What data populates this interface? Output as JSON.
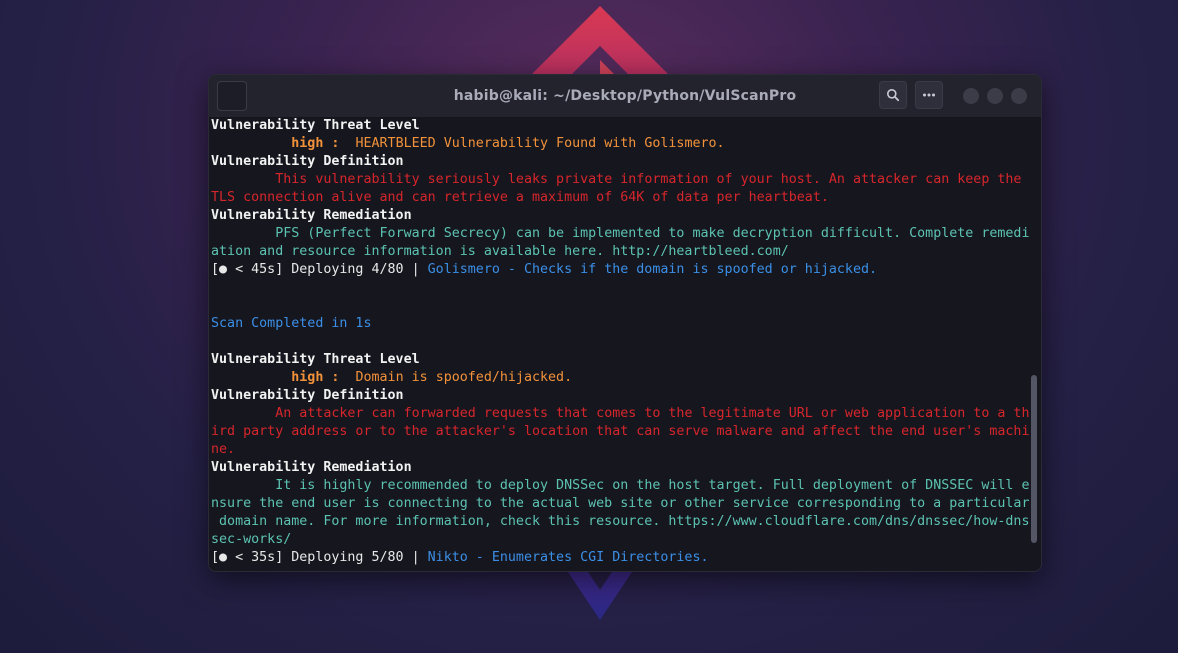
{
  "window": {
    "title": "habib@kali: ~/Desktop/Python/VulScanPro"
  },
  "colors": {
    "threat_high": "#f2923a",
    "definition_text": "#d6262b",
    "remediation_text": "#5cc3b1",
    "deploy_info": "#3b8fe6",
    "terminal_bg": "#16161e"
  },
  "icons": {
    "search": "search-icon",
    "menu": "more-dots-icon"
  },
  "terminal": {
    "block1": {
      "threat_heading": "Vulnerability Threat Level",
      "severity_label": "high : ",
      "threat_text": " HEARTBLEED Vulnerability Found with Golismero.",
      "definition_heading": "Vulnerability Definition",
      "definition_line1": "This vulnerability seriously leaks private information of your host. An attacker can keep the",
      "definition_line2": "TLS connection alive and can retrieve a maximum of 64K of data per heartbeat.",
      "remediation_heading": "Vulnerability Remediation",
      "remediation_line1": "PFS (Perfect Forward Secrecy) can be implemented to make decryption difficult. Complete remedi",
      "remediation_line2": "ation and resource information is available here. http://heartbleed.com/",
      "deploy_prefix": "[● < 45s] Deploying 4/80 | ",
      "deploy_desc": "Golismero - Checks if the domain is spoofed or hijacked."
    },
    "scan_completed": "Scan Completed in 1s",
    "block2": {
      "threat_heading": "Vulnerability Threat Level",
      "severity_label": "high : ",
      "threat_text": " Domain is spoofed/hijacked.",
      "definition_heading": "Vulnerability Definition",
      "definition_line1": "An attacker can forwarded requests that comes to the legitimate URL or web application to a th",
      "definition_line2": "ird party address or to the attacker's location that can serve malware and affect the end user's machi",
      "definition_line3": "ne.",
      "remediation_heading": "Vulnerability Remediation",
      "remediation_line1": "It is highly recommended to deploy DNSSec on the host target. Full deployment of DNSSEC will e",
      "remediation_line2": "nsure the end user is connecting to the actual web site or other service corresponding to a particular",
      "remediation_line3": " domain name. For more information, check this resource. https://www.cloudflare.com/dns/dnssec/how-dns",
      "remediation_line4": "sec-works/",
      "deploy_prefix": "[● < 35s] Deploying 5/80 | ",
      "deploy_desc": "Nikto - Enumerates CGI Directories."
    }
  }
}
